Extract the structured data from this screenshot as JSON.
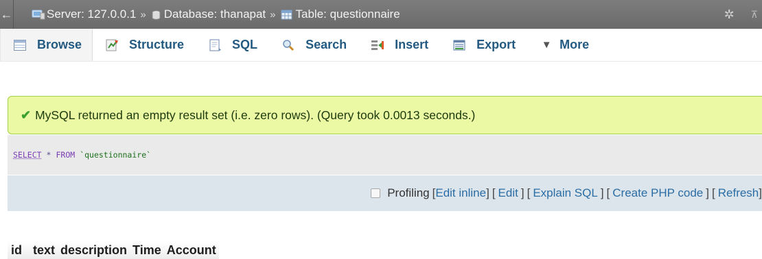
{
  "breadcrumb": {
    "server_label": "Server: 127.0.0.1",
    "database_label": "Database: thanapat",
    "table_label": "Table: questionnaire",
    "separator": "»"
  },
  "tabs": [
    {
      "label": "Browse",
      "icon": "browse-icon"
    },
    {
      "label": "Structure",
      "icon": "structure-icon"
    },
    {
      "label": "SQL",
      "icon": "sql-icon"
    },
    {
      "label": "Search",
      "icon": "search-icon"
    },
    {
      "label": "Insert",
      "icon": "insert-icon"
    },
    {
      "label": "Export",
      "icon": "export-icon"
    },
    {
      "label": "More",
      "icon": "caret-down-icon"
    }
  ],
  "message": {
    "text": "MySQL returned an empty result set (i.e. zero rows). (Query took 0.0013 seconds.)"
  },
  "query": {
    "select": "SELECT",
    "star": "*",
    "from": "FROM",
    "table": "`questionnaire`"
  },
  "profiling": {
    "checkbox_label": "Profiling",
    "links": [
      "Edit inline",
      "Edit",
      "Explain SQL",
      "Create PHP code",
      "Refresh"
    ]
  },
  "columns": [
    "id",
    "text",
    "description",
    "Time",
    "Account"
  ],
  "colors": {
    "topbar": "#6f6f6f",
    "tab_text": "#235a81",
    "success_bg": "#ebf8a4",
    "success_border": "#a2d246",
    "sql_bg": "#eaeaea",
    "profiling_bg": "#dce4ec",
    "link": "#2b6da5"
  }
}
